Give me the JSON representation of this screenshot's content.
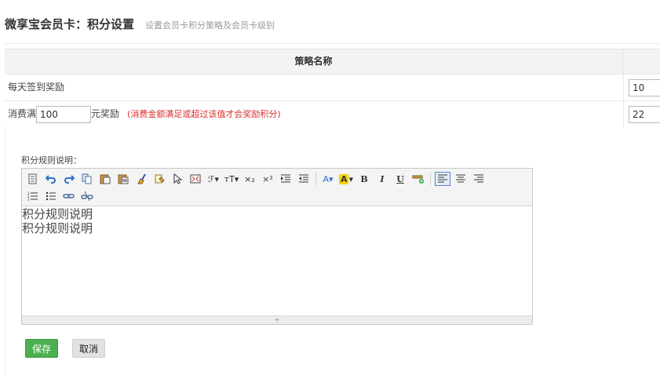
{
  "header": {
    "title": "微享宝会员卡：积分设置",
    "subtitle": "设置会员卡积分策略及会员卡级别"
  },
  "table": {
    "column_name": "策略名称",
    "rows": {
      "checkin": {
        "label": "每天签到奖励",
        "value": "10"
      },
      "spend": {
        "prefix": "消费满",
        "amount": "100",
        "suffix": "元奖励",
        "hint": "(消费金额满足或超过该值才会奖励积分)",
        "value": "22"
      }
    }
  },
  "editor": {
    "label": "积分规则说明：",
    "content_lines": [
      "积分规则说明",
      "积分规则说明"
    ],
    "toolbar": {
      "font_family": "ℱ▾",
      "font_size": "тT▾",
      "subscript": "×₂",
      "superscript": "×²",
      "font_color": "A▾",
      "highlight": "A",
      "bold": "B",
      "italic": "I",
      "underline": "U",
      "resize_handle": "÷"
    }
  },
  "buttons": {
    "save": "保存",
    "cancel": "取消"
  },
  "colors": {
    "save_bg": "#4cb050",
    "hint": "#d9302c",
    "accent": "#2e6fd1"
  }
}
